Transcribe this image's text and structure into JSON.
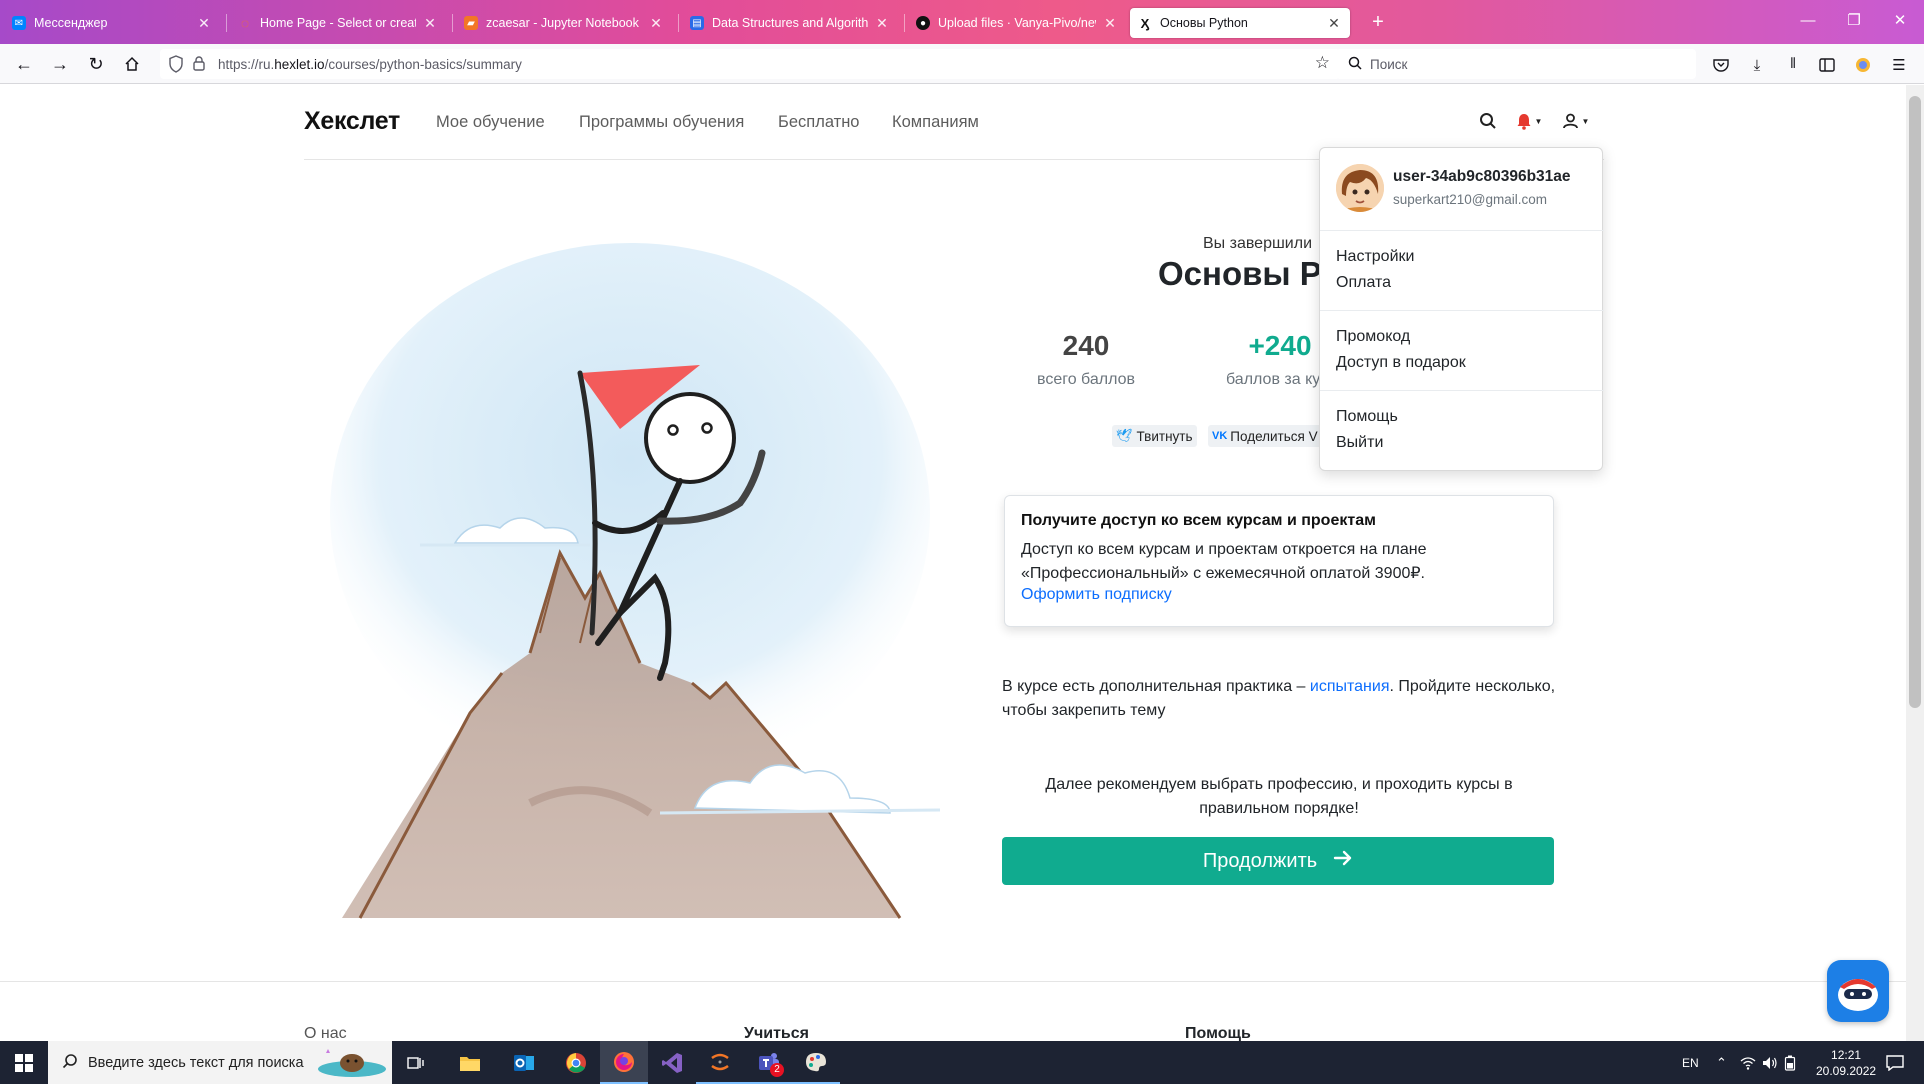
{
  "browser": {
    "tabs": [
      {
        "title": "Мессенджер",
        "icon": "messenger-icon",
        "color": "#0084ff"
      },
      {
        "title": "Home Page - Select or create a",
        "icon": "jupyter-icon",
        "color": "#f37626"
      },
      {
        "title": "zcaesar - Jupyter Notebook",
        "icon": "notebook-icon",
        "color": "#f37626"
      },
      {
        "title": "Data Structures and Algorithms",
        "icon": "page-icon",
        "color": "#2a6ae8"
      },
      {
        "title": "Upload files · Vanya-Pivo/new_",
        "icon": "github-icon",
        "color": "#111111"
      },
      {
        "title": "Основы Python",
        "icon": "hexlet-icon",
        "color": "#111111"
      }
    ],
    "new_tab": "+",
    "url_prefix": "https://ru.",
    "url_domain": "hexlet.io",
    "url_path": "/courses/python-basics/summary",
    "search_placeholder": "Поиск"
  },
  "site": {
    "logo": "Хекслет",
    "menu": [
      "Мое обучение",
      "Программы обучения",
      "Бесплатно",
      "Компаниям"
    ]
  },
  "summary": {
    "completed_text": "Вы завершили",
    "course_name": "Основы Py",
    "total_points": "240",
    "total_points_label": "всего баллов",
    "course_points": "+240",
    "course_points_label": "баллов за ку",
    "tweet_label": "Твитнуть",
    "vk_label": "Поделиться V"
  },
  "promo": {
    "title": "Получите доступ ко всем курсам и проектам",
    "body": "Доступ ко всем курсам и проектам откроется на плане «Профессиональный» с ежемесячной оплатой 3900₽.",
    "link": "Оформить подписку"
  },
  "practice": {
    "before": "В курсе есть дополнительная практика – ",
    "link": "испытания",
    "after": ". Пройдите несколько, чтобы закрепить тему"
  },
  "recommend": "Далее рекомендуем выбрать профессию, и проходить курсы в правильном порядке!",
  "continue_label": "Продолжить",
  "footer": {
    "col1": "О нас",
    "col2": "Учиться",
    "col3": "Помощь"
  },
  "user_menu": {
    "username": "user-34ab9c80396b31ae",
    "email": "superkart210@gmail.com",
    "group1": [
      "Настройки",
      "Оплата"
    ],
    "group2": [
      "Промокод",
      "Доступ в подарок"
    ],
    "group3": [
      "Помощь",
      "Выйти"
    ]
  },
  "taskbar": {
    "search_placeholder": "Введите здесь текст для поиска",
    "lang": "EN",
    "time": "12:21",
    "date": "20.09.2022",
    "teams_badge": "2"
  },
  "colors": {
    "accent": "#10ab8f",
    "link": "#0d6efd",
    "notification": "#e5392f"
  }
}
